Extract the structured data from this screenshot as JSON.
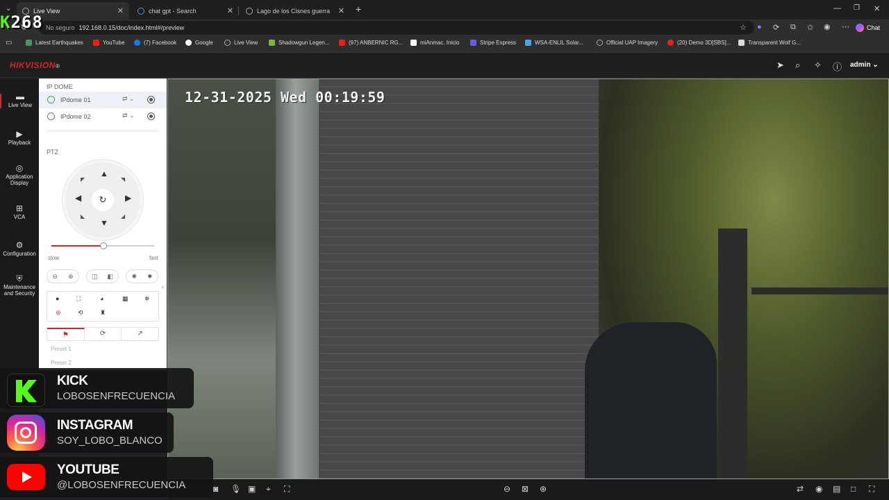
{
  "browser": {
    "tabs": [
      {
        "label": "Live View",
        "active": true
      },
      {
        "label": "chat gpt - Search",
        "active": false
      },
      {
        "label": "Lago de los Cisnes guerra",
        "active": false
      }
    ],
    "new_tab": "+",
    "address": {
      "security": "No seguro",
      "url": "192.168.0.15/doc/index.html#/preview"
    },
    "chat_button": "Chat",
    "bookmarks": [
      {
        "label": "Latest Earthquakes",
        "color": "#3a9d5d"
      },
      {
        "label": "YouTube",
        "color": "#e62117"
      },
      {
        "label": "(7) Facebook",
        "color": "#1877f2"
      },
      {
        "label": "Google",
        "color": "#ffffff"
      },
      {
        "label": "Live View",
        "color": "#9aa0a6"
      },
      {
        "label": "Shadowgun Legen...",
        "color": "#7cb342"
      },
      {
        "label": "(97) ANBERNIC RG...",
        "color": "#e62117"
      },
      {
        "label": "miAnmac. Inicio",
        "color": "#ffffff"
      },
      {
        "label": "Stripe Express",
        "color": "#635bff"
      },
      {
        "label": "WSA-ENLIL Solar...",
        "color": "#4fa3e0"
      },
      {
        "label": "Official UAP Imagery",
        "color": "#9aa0a6"
      },
      {
        "label": "(20) Demo 3D[SBS]...",
        "color": "#e62117"
      },
      {
        "label": "Transparent Wolf G...",
        "color": "#dcdcdc"
      }
    ]
  },
  "app": {
    "brand": "HIKVISION",
    "brand_mark": "®",
    "user": "admin",
    "accent": "#d7232c"
  },
  "nav": [
    {
      "label": "Live View",
      "icon": "live-view-icon"
    },
    {
      "label": "Playback",
      "icon": "playback-icon"
    },
    {
      "label": "Application Display",
      "icon": "application-icon"
    },
    {
      "label": "VCA",
      "icon": "vca-icon"
    },
    {
      "label": "Configuration",
      "icon": "gear-icon"
    },
    {
      "label": "Maintenance and Security",
      "icon": "maintenance-icon"
    }
  ],
  "panel": {
    "group_title": "IP DOME",
    "cameras": [
      "IPdome 01",
      "IPdome 02"
    ],
    "ptz_title": "PTZ",
    "speed": {
      "slow": "slow",
      "fast": "fast",
      "level": 0.51
    },
    "presets": [
      "Preset 1",
      "Preset 2"
    ]
  },
  "video": {
    "osd": "12-31-2025 Wed 00:19:59"
  },
  "overlay": {
    "counter": "268",
    "counter_prefix": "K",
    "socials": [
      {
        "title": "KICK",
        "handle": "LOBOSENFRECUENCIA",
        "color": "#53fc18"
      },
      {
        "title": "INSTAGRAM",
        "handle": "SOY_LOBO_BLANCO",
        "color": "#d6249f"
      },
      {
        "title": "YOUTUBE",
        "handle": "@LOBOSENFRECUENCIA",
        "color": "#ff0000"
      }
    ]
  }
}
